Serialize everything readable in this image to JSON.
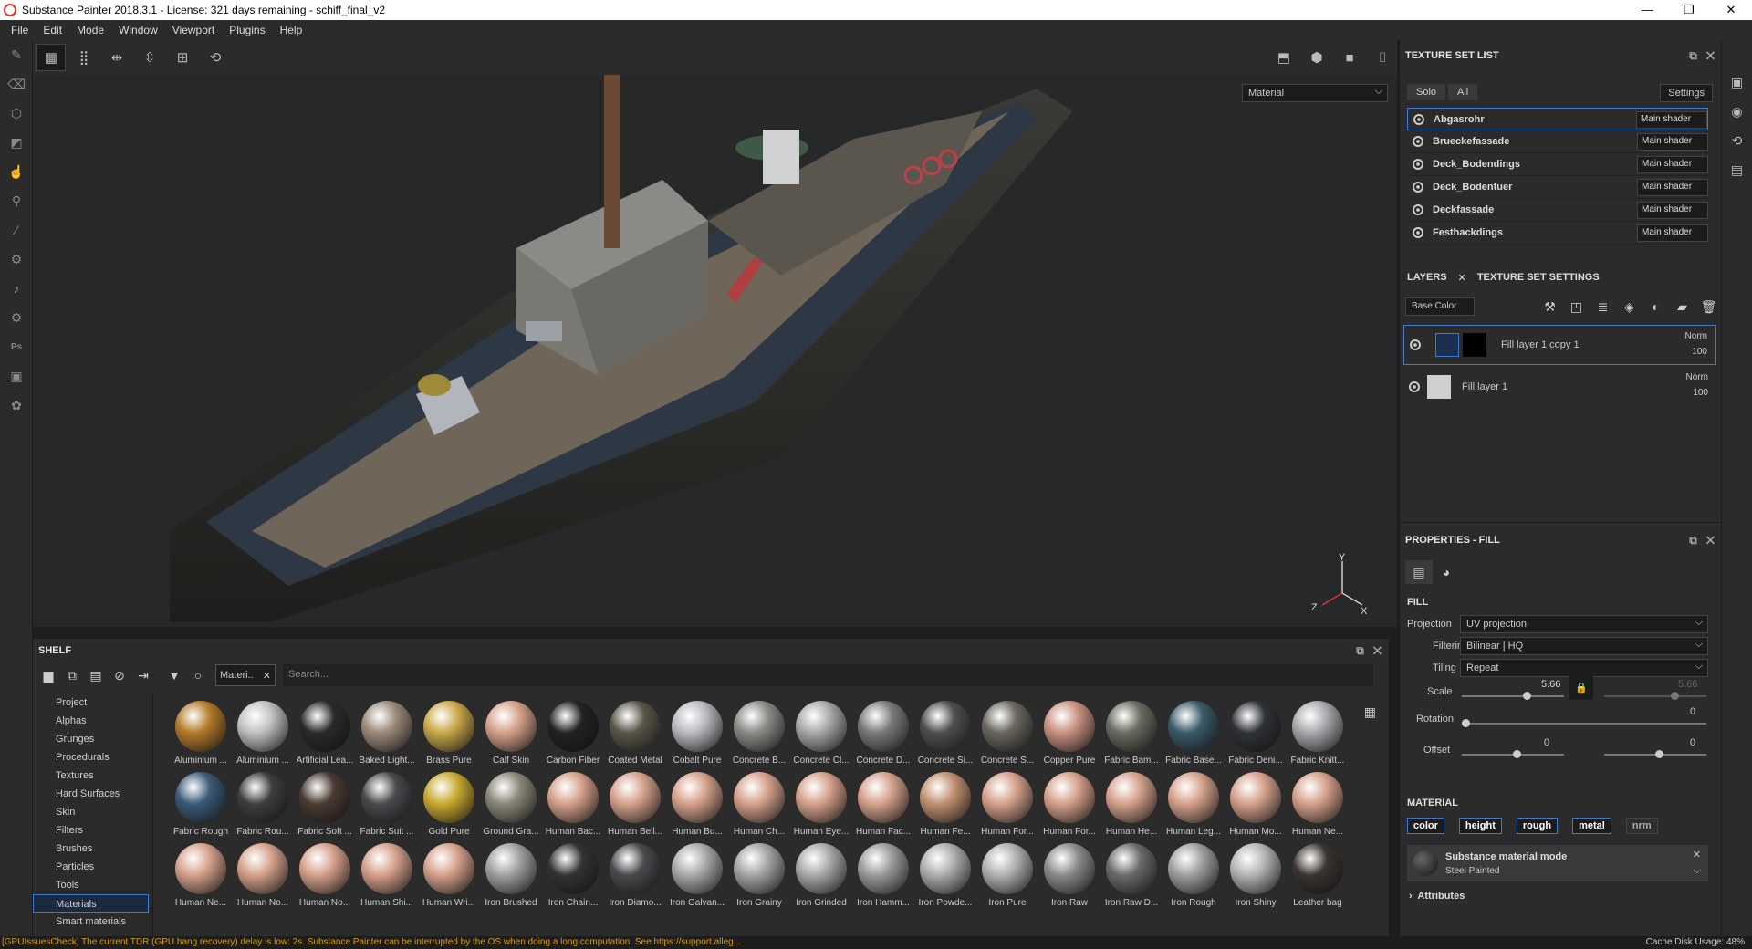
{
  "window": {
    "title": "Substance Painter 2018.3.1 - License: 321 days remaining - schiff_final_v2"
  },
  "menu": [
    "File",
    "Edit",
    "Mode",
    "Window",
    "Viewport",
    "Plugins",
    "Help"
  ],
  "viewport": {
    "channel_select": "Material",
    "axes": {
      "x": "X",
      "y": "Y",
      "z": "Z"
    }
  },
  "shelf": {
    "title": "SHELF",
    "filter_chip": "Materi..",
    "search_placeholder": "Search...",
    "categories": [
      "Project",
      "Alphas",
      "Grunges",
      "Procedurals",
      "Textures",
      "Hard Surfaces",
      "Skin",
      "Filters",
      "Brushes",
      "Particles",
      "Tools",
      "Materials",
      "Smart materials"
    ],
    "selected_category": "Materials",
    "materials": [
      {
        "label": "Aluminium ...",
        "color": "#b47a2a"
      },
      {
        "label": "Aluminium ...",
        "color": "#c0c0c0"
      },
      {
        "label": "Artificial Lea...",
        "color": "#2a2a2a"
      },
      {
        "label": "Baked Light...",
        "color": "#9a8a78"
      },
      {
        "label": "Brass Pure",
        "color": "#c9a84a"
      },
      {
        "label": "Calf Skin",
        "color": "#d4a08a"
      },
      {
        "label": "Carbon Fiber",
        "color": "#222222"
      },
      {
        "label": "Coated Metal",
        "color": "#5a5548"
      },
      {
        "label": "Cobalt Pure",
        "color": "#b8b8c0"
      },
      {
        "label": "Concrete B...",
        "color": "#8a8a86"
      },
      {
        "label": "Concrete Cl...",
        "color": "#a8a8a8"
      },
      {
        "label": "Concrete D...",
        "color": "#7a7a7a"
      },
      {
        "label": "Concrete Si...",
        "color": "#4e4e4e"
      },
      {
        "label": "Concrete S...",
        "color": "#6a665e"
      },
      {
        "label": "Copper Pure",
        "color": "#c89080"
      },
      {
        "label": "Fabric Bam...",
        "color": "#6a6a60"
      },
      {
        "label": "Fabric Base...",
        "color": "#3a5a68"
      },
      {
        "label": "Fabric Deni...",
        "color": "#2e3238"
      },
      {
        "label": "Fabric Knitt...",
        "color": "#a8a8ac"
      },
      {
        "label": "Fabric Rough",
        "color": "#3a5a78"
      },
      {
        "label": "Fabric Rou...",
        "color": "#3e3e3e"
      },
      {
        "label": "Fabric Soft ...",
        "color": "#4a3a32"
      },
      {
        "label": "Fabric Suit ...",
        "color": "#4a4a4e"
      },
      {
        "label": "Gold Pure",
        "color": "#c8a830"
      },
      {
        "label": "Ground Gra...",
        "color": "#8a8678"
      },
      {
        "label": "Human Bac...",
        "color": "#d4a08a"
      },
      {
        "label": "Human Bell...",
        "color": "#d4a08a"
      },
      {
        "label": "Human Bu...",
        "color": "#d4a08a"
      },
      {
        "label": "Human Ch...",
        "color": "#d4a08a"
      },
      {
        "label": "Human Eye...",
        "color": "#d4a08a"
      },
      {
        "label": "Human Fac...",
        "color": "#d4a08a"
      },
      {
        "label": "Human Fe...",
        "color": "#c09070"
      },
      {
        "label": "Human For...",
        "color": "#d4a08a"
      },
      {
        "label": "Human For...",
        "color": "#d4a08a"
      },
      {
        "label": "Human He...",
        "color": "#d4a08a"
      },
      {
        "label": "Human Leg...",
        "color": "#d4a08a"
      },
      {
        "label": "Human Mo...",
        "color": "#d4a08a"
      },
      {
        "label": "Human Ne...",
        "color": "#d4a08a"
      },
      {
        "label": "Human Ne...",
        "color": "#d4a08a"
      },
      {
        "label": "Human No...",
        "color": "#d4a08a"
      },
      {
        "label": "Human No...",
        "color": "#d4a08a"
      },
      {
        "label": "Human Shi...",
        "color": "#d4a08a"
      },
      {
        "label": "Human Wri...",
        "color": "#d4a08a"
      },
      {
        "label": "Iron Brushed",
        "color": "#a0a0a2"
      },
      {
        "label": "Iron Chain...",
        "color": "#333333"
      },
      {
        "label": "Iron Diamo...",
        "color": "#4a4a4e"
      },
      {
        "label": "Iron Galvan...",
        "color": "#a8a8aa"
      },
      {
        "label": "Iron Grainy",
        "color": "#a4a4a6"
      },
      {
        "label": "Iron Grinded",
        "color": "#a8a8aa"
      },
      {
        "label": "Iron Hamm...",
        "color": "#9a9a9c"
      },
      {
        "label": "Iron Powde...",
        "color": "#acacae"
      },
      {
        "label": "Iron Pure",
        "color": "#b0b0b2"
      },
      {
        "label": "Iron Raw",
        "color": "#8a8a8c"
      },
      {
        "label": "Iron Raw D...",
        "color": "#6a6a6c"
      },
      {
        "label": "Iron Rough",
        "color": "#9e9ea0"
      },
      {
        "label": "Iron Shiny",
        "color": "#b4b4b6"
      },
      {
        "label": "Leather bag",
        "color": "#3a3430"
      }
    ]
  },
  "texture_set_list": {
    "title": "TEXTURE SET LIST",
    "solo": "Solo",
    "all": "All",
    "settings": "Settings",
    "sets": [
      {
        "name": "Abgasrohr",
        "shader": "Main shader"
      },
      {
        "name": "Brueckefassade",
        "shader": "Main shader"
      },
      {
        "name": "Deck_Bodendings",
        "shader": "Main shader"
      },
      {
        "name": "Deck_Bodentuer",
        "shader": "Main shader"
      },
      {
        "name": "Deckfassade",
        "shader": "Main shader"
      },
      {
        "name": "Festhackdings",
        "shader": "Main shader"
      }
    ]
  },
  "layers": {
    "tab_layers": "LAYERS",
    "tab_tss": "TEXTURE SET SETTINGS",
    "channel": "Base Color",
    "items": [
      {
        "name": "Fill layer 1 copy 1",
        "blend": "Norm",
        "opacity": "100"
      },
      {
        "name": "Fill layer 1",
        "blend": "Norm",
        "opacity": "100"
      }
    ]
  },
  "properties": {
    "title": "PROPERTIES - FILL",
    "fill_header": "FILL",
    "projection_label": "Projection",
    "projection": "UV projection",
    "filtering_label": "Filtering",
    "filtering": "Bilinear | HQ",
    "tiling_label": "Tiling",
    "tiling": "Repeat",
    "scale_label": "Scale",
    "scale_value": "5.66",
    "scale_value2": "5.66",
    "scale_fraction": 0.6,
    "rotation_label": "Rotation",
    "rotation_value": "0",
    "offset_label": "Offset",
    "offset_x": "0",
    "offset_y": "0",
    "material_header": "MATERIAL",
    "channels": [
      "color",
      "height",
      "rough",
      "metal",
      "nrm"
    ],
    "mode_title": "Substance material mode",
    "mode_value": "Steel Painted",
    "attributes": "Attributes"
  },
  "status": {
    "warning": "[GPUIssuesCheck] The current TDR (GPU hang recovery) delay is low: 2s. Substance Painter can be interrupted by the OS when doing a long computation. See https://support.alleg...",
    "cache": "Cache Disk Usage:  48%"
  }
}
